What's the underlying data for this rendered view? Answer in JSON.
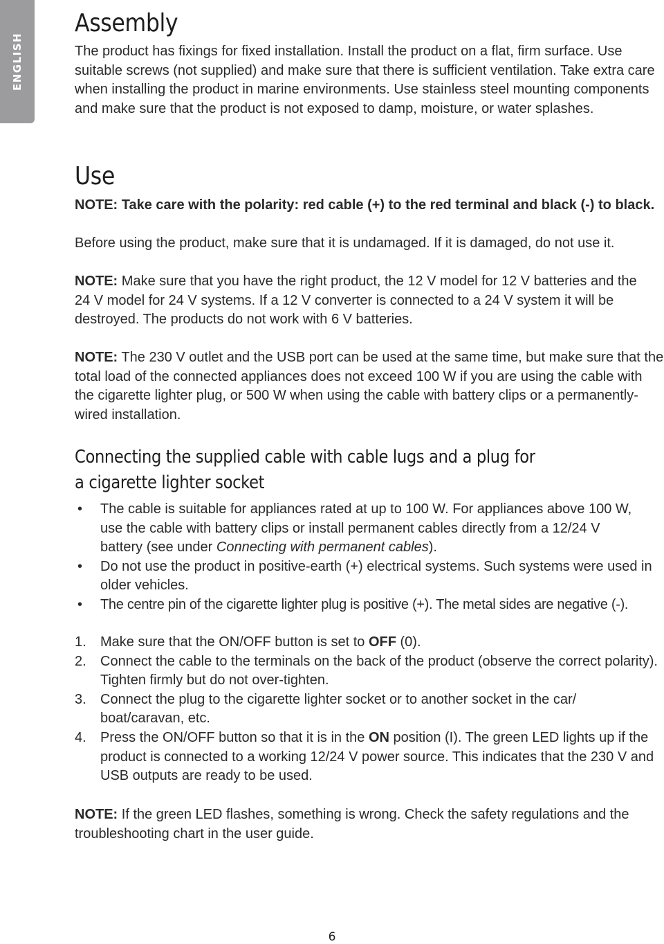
{
  "side_tab": {
    "label": "ENGLISH"
  },
  "sections": {
    "assembly": {
      "heading": "Assembly",
      "body": "The product has fixings for fixed installation. Install the product on a flat, firm surface. Use suitable screws (not supplied) and make sure that there is sufficient ventilation. Take extra care when installing the product in marine environments. Use stainless steel mounting components and make sure that the product is not exposed to damp, moisture, or water splashes."
    },
    "use": {
      "heading": "Use",
      "polarity_note": "NOTE: Take care with the polarity: red cable (+) to the red terminal and black (-) to black.",
      "inspect_text": "Before using the product, make sure that it is undamaged. If it is damaged, do not use it.",
      "note_label": "NOTE:",
      "model_note": "Make sure that you have the right product, the 12 V model for 12 V batteries and the 24 V model for 24 V systems. If a 12 V converter is connected to a 24 V system it will be destroyed. The products do not work with 6 V batteries.",
      "load_note": "The 230 V outlet and the USB port can be used at the same time, but make sure that the total load of the connected appliances does not exceed 100 W if you are using the cable with the cigarette lighter plug, or 500 W when using the cable with battery clips or a permanently-wired installation."
    },
    "connecting": {
      "heading_line1": "Connecting the supplied cable with cable lugs and a plug for",
      "heading_line2": "a cigarette lighter socket",
      "bullets": [
        {
          "before": "The cable is suitable for appliances rated at up to 100 W. For appliances above 100 W, use the cable with battery clips or install permanent cables directly from a 12/24 V battery (see under ",
          "italic": "Connecting with permanent cables",
          "after": ")."
        },
        {
          "before": "Do not use the product in positive-earth (+) electrical systems. Such systems were used in older vehicles.",
          "italic": "",
          "after": ""
        },
        {
          "before": "The centre pin of the cigarette lighter plug is positive (+). The metal sides are negative (-).",
          "italic": "",
          "after": ""
        }
      ],
      "steps": [
        {
          "num": "1.",
          "before": "Make sure that the ON/OFF button is set to ",
          "bold": "OFF",
          "after": " (0)."
        },
        {
          "num": "2.",
          "before": "Connect the cable to the terminals on the back of the product (observe the correct polarity). Tighten firmly but do not over-tighten.",
          "bold": "",
          "after": ""
        },
        {
          "num": "3.",
          "before": "Connect the plug to the cigarette lighter socket or to another socket in the car/ boat/caravan, etc.",
          "bold": "",
          "after": ""
        },
        {
          "num": "4.",
          "before": "Press the ON/OFF button so that it is in the ",
          "bold": "ON",
          "after": " position (I). The green LED lights up if the product is connected to a working 12/24 V power source. This indicates that the 230 V and USB outputs are ready to be used."
        }
      ],
      "led_note": "If the green LED flashes, something is wrong. Check the safety regulations and the troubleshooting chart in the user guide."
    }
  },
  "bullet_char": "•",
  "page_number": "6"
}
